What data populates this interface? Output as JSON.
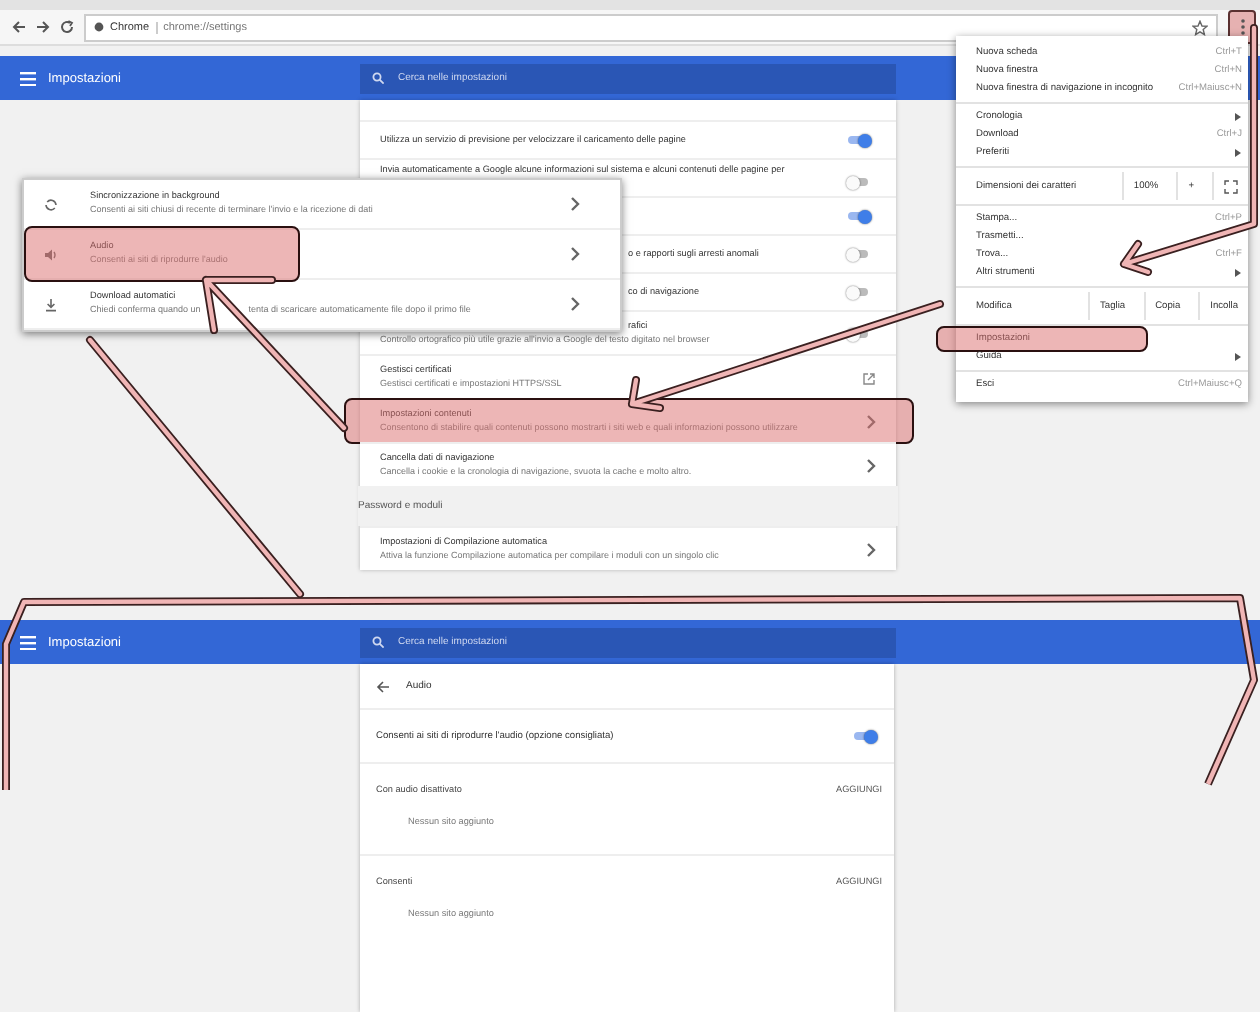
{
  "browser": {
    "site_label": "Chrome",
    "url": "chrome://settings"
  },
  "settings_top": {
    "title": "Impostazioni",
    "search_placeholder": "Cerca nelle impostazioni",
    "rows": [
      {
        "kind": "toggle",
        "title": "Utilizza un servizio di previsione per velocizzare il caricamento delle pagine",
        "on": true
      },
      {
        "kind": "toggle",
        "title": "Invia automaticamente a Google alcune informazioni sul sistema e alcuni contenuti delle pagine per",
        "on": false
      },
      {
        "kind": "toggle",
        "on": true
      },
      {
        "kind": "toggle",
        "title": "o e rapporti sugli arresti anomali",
        "on": false
      },
      {
        "kind": "toggle",
        "title": "co di navigazione",
        "on": false
      },
      {
        "kind": "toggle",
        "title": "rafici",
        "subtitle": "Controllo ortografico più utile grazie all'invio a Google del testo digitato nel browser",
        "on": false
      },
      {
        "kind": "external",
        "title": "Gestisci certificati",
        "subtitle": "Gestisci certificati e impostazioni HTTPS/SSL",
        "highlighted": false
      },
      {
        "kind": "nav",
        "title": "Impostazioni contenuti",
        "subtitle": "Consentono di stabilire quali contenuti possono mostrarti i siti web e quali informazioni possono utilizzare",
        "highlighted": true
      },
      {
        "kind": "nav",
        "title": "Cancella dati di navigazione",
        "subtitle": "Cancella i cookie e la cronologia di navigazione, svuota la cache e molto altro.",
        "highlighted": false
      },
      {
        "kind": "section",
        "title": "Password e moduli"
      },
      {
        "kind": "nav",
        "title": "Impostazioni di Compilazione automatica",
        "subtitle": "Attiva la funzione Compilazione automatica per compilare i moduli con un singolo clic",
        "highlighted": false
      }
    ]
  },
  "popup": [
    {
      "kind": "sync",
      "title": "Sincronizzazione in background",
      "subtitle": "Consenti ai siti chiusi di recente di terminare l'invio e la ricezione di dati",
      "highlighted": false
    },
    {
      "kind": "audio",
      "title": "Audio",
      "subtitle": "Consenti ai siti di riprodurre l'audio",
      "highlighted": true
    },
    {
      "kind": "download",
      "title": "Download automatici",
      "subtitle": [
        "Chiedi conferma quando un",
        "tenta di scaricare automaticamente file dopo il primo file"
      ],
      "highlighted": false
    }
  ],
  "menu": [
    [
      {
        "kind": "item",
        "label": "Nuova scheda",
        "shortcut": "Ctrl+T",
        "highlighted": false
      },
      {
        "kind": "item",
        "label": "Nuova finestra",
        "shortcut": "Ctrl+N",
        "highlighted": false
      },
      {
        "kind": "item",
        "label": "Nuova finestra di navigazione in incognito",
        "shortcut": "Ctrl+Maiusc+N",
        "highlighted": false
      }
    ],
    [
      {
        "kind": "submenu",
        "label": "Cronologia",
        "highlighted": false
      },
      {
        "kind": "item",
        "label": "Download",
        "shortcut": "Ctrl+J",
        "highlighted": false
      },
      {
        "kind": "submenu",
        "label": "Preferiti",
        "highlighted": false
      }
    ],
    [
      {
        "kind": "zoom",
        "label": "Dimensioni dei caratteri",
        "value": "100%",
        "control": "+"
      }
    ],
    [
      {
        "kind": "item",
        "label": "Stampa...",
        "shortcut": "Ctrl+P",
        "highlighted": false
      },
      {
        "kind": "item",
        "label": "Trasmetti...",
        "highlighted": false
      },
      {
        "kind": "item",
        "label": "Trova...",
        "shortcut": "Ctrl+F",
        "highlighted": false
      },
      {
        "kind": "submenu",
        "label": "Altri strumenti",
        "highlighted": false
      }
    ],
    [
      {
        "kind": "edit",
        "label": "Modifica",
        "buttons": [
          "Taglia",
          "Copia",
          "Incolla"
        ]
      }
    ],
    [
      {
        "kind": "item",
        "label": "Impostazioni",
        "highlighted": true
      },
      {
        "kind": "submenu",
        "label": "Guida",
        "highlighted": false
      }
    ],
    [
      {
        "kind": "item",
        "label": "Esci",
        "shortcut": "Ctrl+Maiusc+Q",
        "highlighted": false
      }
    ]
  ],
  "settings_bottom": {
    "title": "Impostazioni",
    "search_placeholder": "Cerca nelle impostazioni",
    "page_title": "Audio",
    "toggle": {
      "label": "Consenti ai siti di riprodurre l'audio (opzione consigliata)",
      "on": true
    },
    "sections": [
      {
        "title": "Con audio disattivato",
        "action": "AGGIUNGI",
        "empty": "Nessun sito aggiunto"
      },
      {
        "title": "Consenti",
        "action": "AGGIUNGI",
        "empty": "Nessun sito aggiunto"
      }
    ]
  }
}
